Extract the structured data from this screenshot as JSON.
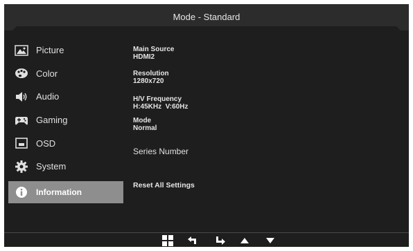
{
  "header": {
    "title": "Mode - Standard"
  },
  "sidebar": {
    "items": [
      {
        "label": "Picture",
        "icon": "picture-icon"
      },
      {
        "label": "Color",
        "icon": "palette-icon"
      },
      {
        "label": "Audio",
        "icon": "speaker-icon"
      },
      {
        "label": "Gaming",
        "icon": "gamepad-icon"
      },
      {
        "label": "OSD",
        "icon": "osd-icon"
      },
      {
        "label": "System",
        "icon": "gear-icon"
      },
      {
        "label": "Information",
        "icon": "info-icon",
        "active": true
      }
    ]
  },
  "info": {
    "main_source": {
      "label": "Main Source",
      "value": "HDMI2"
    },
    "resolution": {
      "label": "Resolution",
      "value": "1280x720"
    },
    "frequency": {
      "label": "H/V Frequency",
      "value": "H:45KHz  V:60Hz"
    },
    "mode": {
      "label": "Mode",
      "value": "Normal"
    },
    "series_number": {
      "label": "Series Number"
    },
    "reset": {
      "label": "Reset All Settings"
    }
  },
  "footer": {
    "buttons": [
      "menu-grid-icon",
      "back-icon",
      "enter-icon",
      "up-arrow-icon",
      "down-arrow-icon"
    ]
  },
  "colors": {
    "panel": "#1e1e1e",
    "header": "#2b2b2b",
    "active_item": "#8e8e8e",
    "text": "#e6e6e6"
  }
}
